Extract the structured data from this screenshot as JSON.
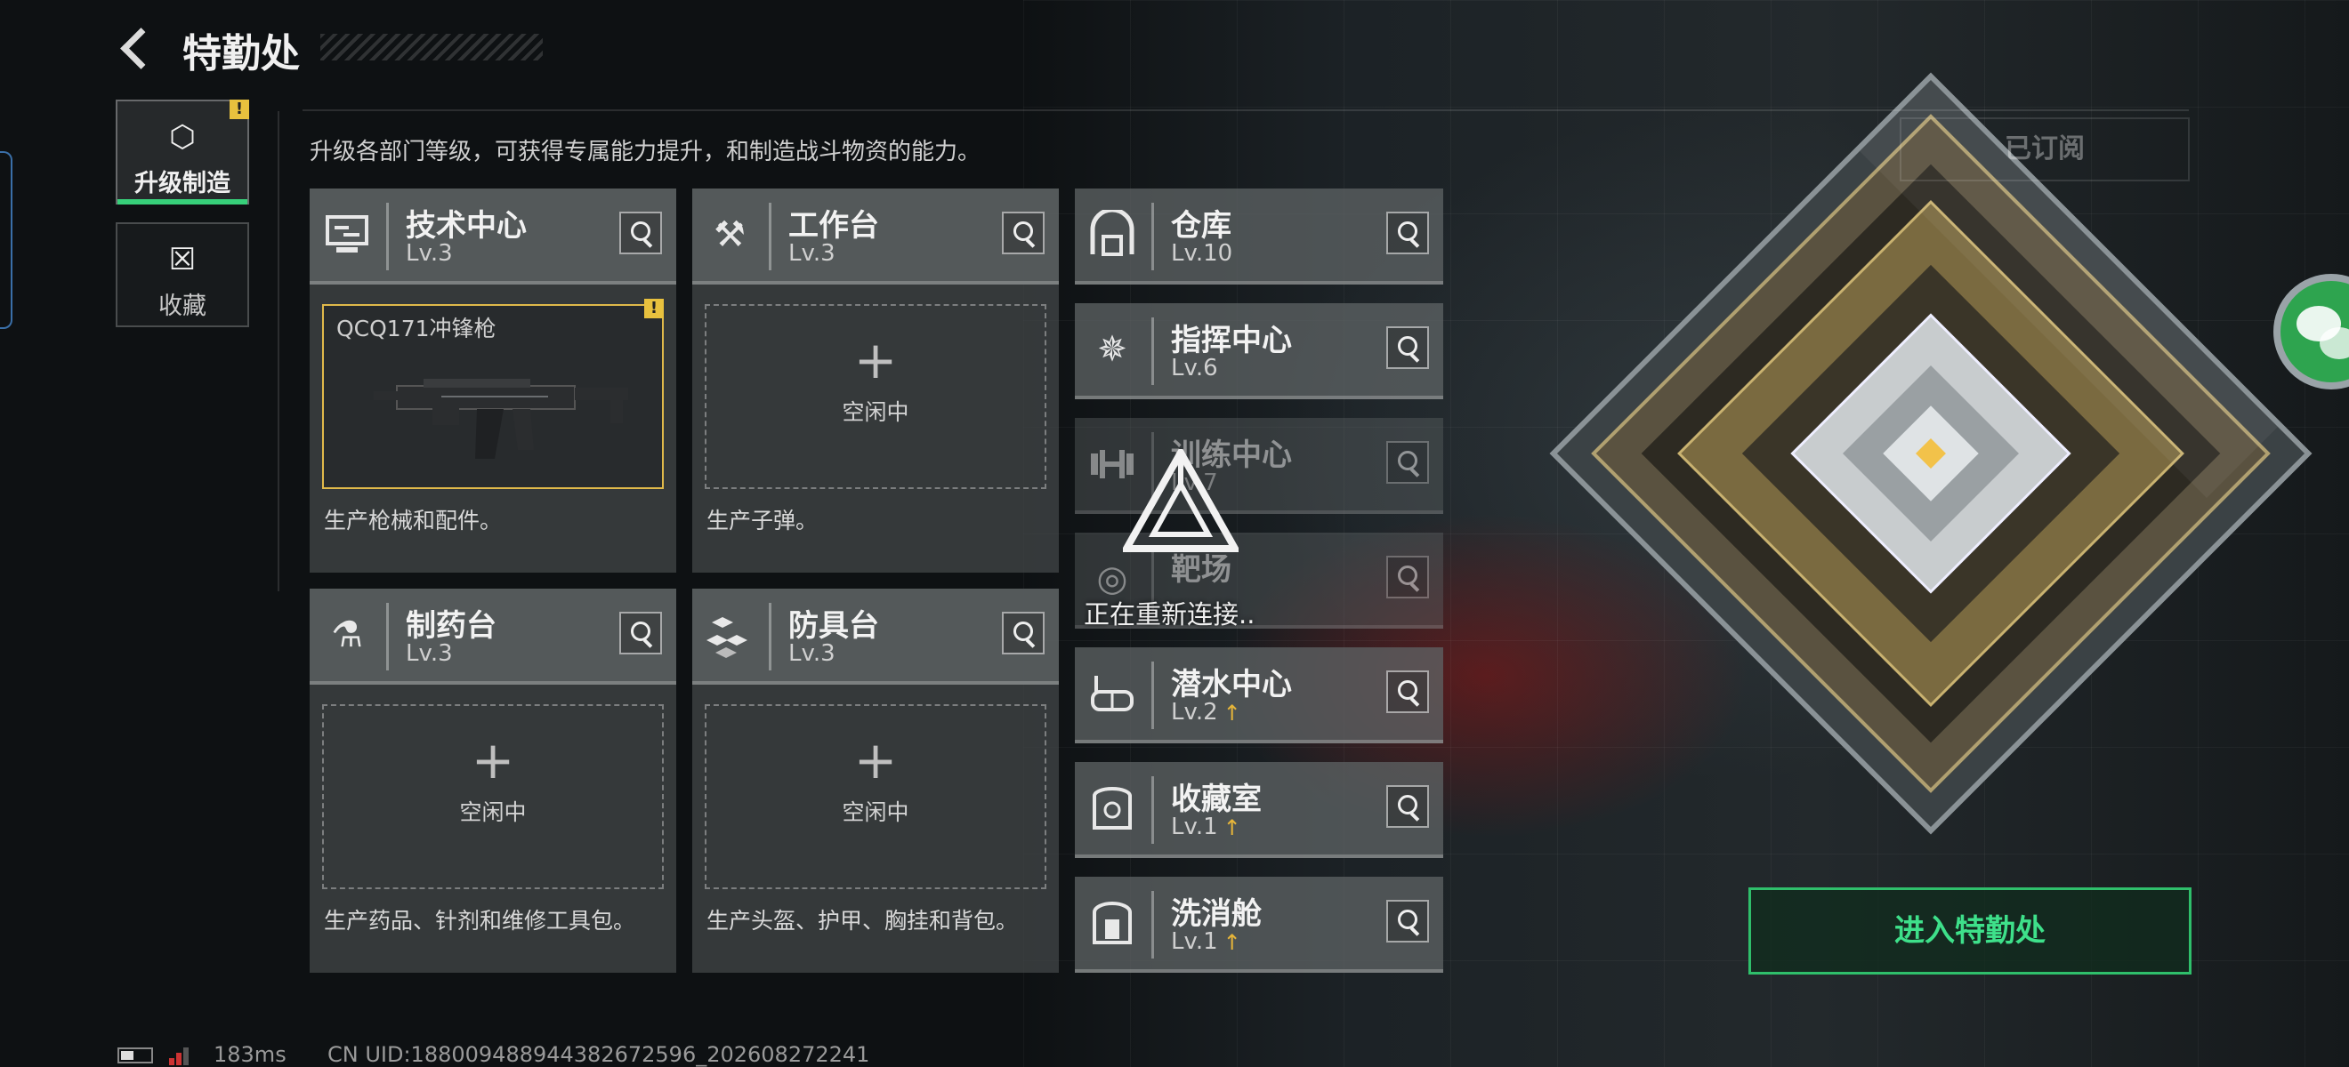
{
  "header": {
    "title": "特勤处",
    "description": "升级各部门等级，可获得专属能力提升，和制造战斗物资的能力。"
  },
  "tabs": [
    {
      "label": "升级制造",
      "icon": "upgrade-craft-icon",
      "active": true,
      "alert": "!"
    },
    {
      "label": "收藏",
      "icon": "collection-icon",
      "active": false
    }
  ],
  "stations": [
    {
      "name": "技术中心",
      "level": "Lv.3",
      "icon": "tech-center-icon",
      "slot": {
        "state": "producing",
        "item": "QCQ171冲锋枪",
        "alert": "!"
      },
      "desc": "生产枪械和配件。"
    },
    {
      "name": "工作台",
      "level": "Lv.3",
      "icon": "workbench-icon",
      "slot": {
        "state": "idle",
        "label": "空闲中"
      },
      "desc": "生产子弹。"
    },
    {
      "name": "制药台",
      "level": "Lv.3",
      "icon": "pharmacy-icon",
      "slot": {
        "state": "idle",
        "label": "空闲中"
      },
      "desc": "生产药品、针剂和维修工具包。"
    },
    {
      "name": "防具台",
      "level": "Lv.3",
      "icon": "armor-bench-icon",
      "slot": {
        "state": "idle",
        "label": "空闲中"
      },
      "desc": "生产头盔、护甲、胸挂和背包。"
    }
  ],
  "facilities": [
    {
      "name": "仓库",
      "level": "Lv.10",
      "icon": "warehouse-icon",
      "upgradable": false
    },
    {
      "name": "指挥中心",
      "level": "Lv.6",
      "icon": "command-center-icon",
      "upgradable": false
    },
    {
      "name": "训练中心",
      "level": "Lv.7",
      "icon": "training-center-icon",
      "upgradable": false
    },
    {
      "name": "靶场",
      "level": "",
      "icon": "shooting-range-icon",
      "upgradable": false
    },
    {
      "name": "潜水中心",
      "level": "Lv.2",
      "icon": "diving-center-icon",
      "upgradable": true
    },
    {
      "name": "收藏室",
      "level": "Lv.1",
      "icon": "collection-room-icon",
      "upgradable": true
    },
    {
      "name": "洗消舱",
      "level": "Lv.1",
      "icon": "decontamination-icon",
      "upgradable": true
    }
  ],
  "overlay": {
    "reconnecting": "正在重新连接.."
  },
  "subscribed_label": "已订阅",
  "enter_button": "进入特勤处",
  "status": {
    "ping": "183ms",
    "uid": "CN UID:1880094889443826725​96_202608272241"
  },
  "colors": {
    "accent_green": "#37d07a",
    "alert_yellow": "#e8c13e",
    "upgrade_gold": "#e6b53a"
  }
}
